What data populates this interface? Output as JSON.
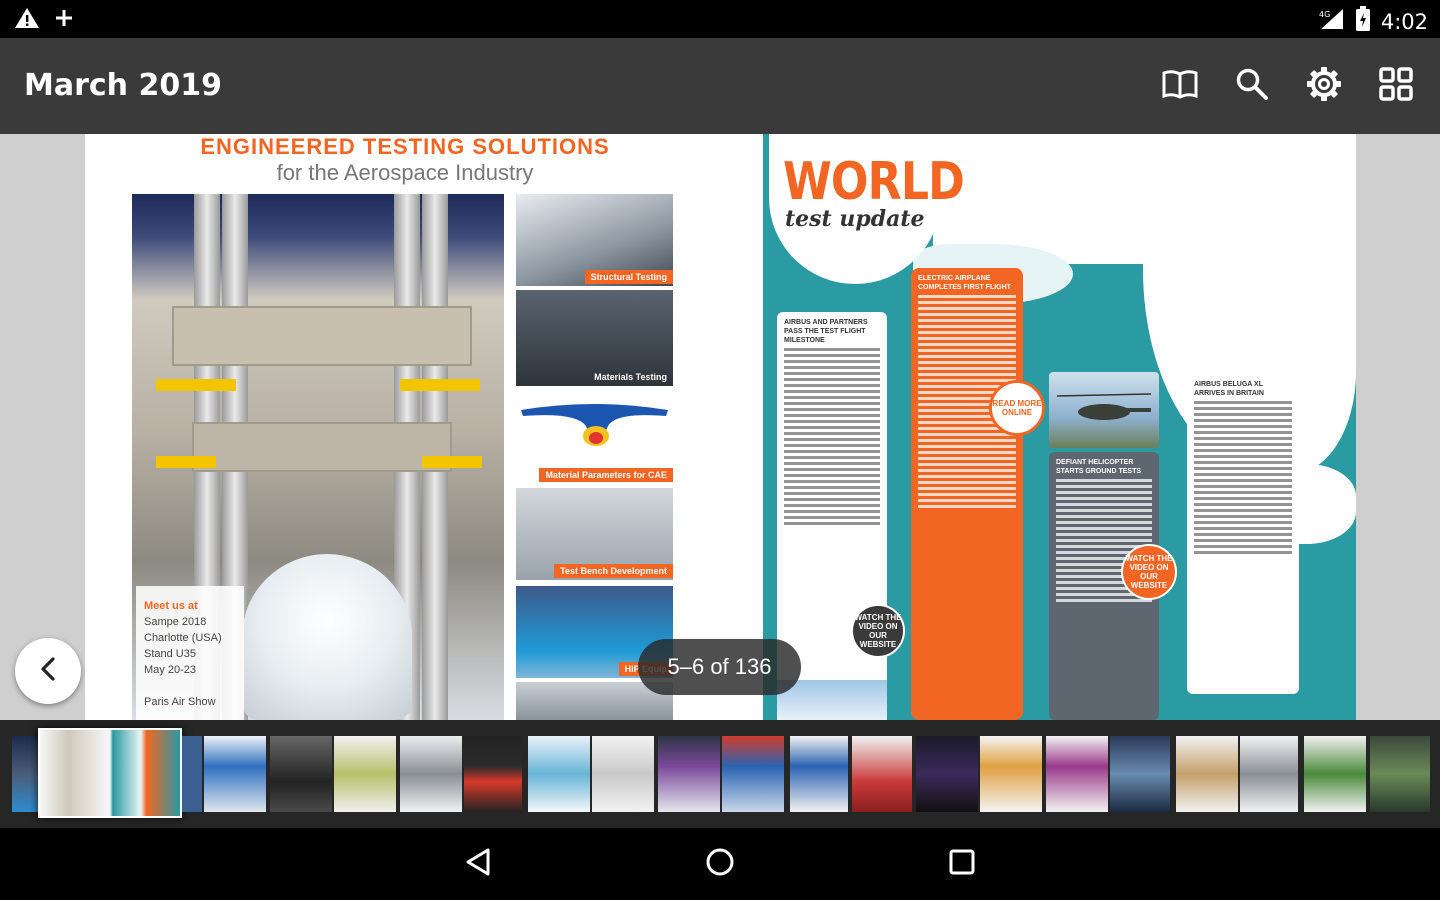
{
  "status_bar": {
    "time": "4:02",
    "left_icons": [
      "warning-icon",
      "plus-icon"
    ],
    "right_icons": [
      "signal-icon",
      "battery-icon"
    ]
  },
  "app_bar": {
    "title": "March 2019",
    "actions": [
      "book-view-icon",
      "search-icon",
      "settings-icon",
      "grid-icon"
    ]
  },
  "reader": {
    "page_indicator": "5–6 of 136",
    "left_page": {
      "headline": "ENGINEERED TESTING SOLUTIONS",
      "subheadline": "for the Aerospace Industry",
      "event_box": {
        "lines": [
          "Meet us at",
          "Sampe 2018",
          "Charlotte (USA)",
          "Stand U35",
          "May 20-23",
          "",
          "Paris Air Show"
        ]
      },
      "thumbnails": [
        {
          "caption": "Structural Testing"
        },
        {
          "caption": "Materials Testing"
        },
        {
          "caption": "Material Parameters for CAE"
        },
        {
          "caption": "Test Bench Development"
        },
        {
          "caption": "HIP Equip"
        }
      ]
    },
    "right_page": {
      "title": "WORLD",
      "subtitle": "test update",
      "articles": [
        {
          "heading": "AIRBUS AND PARTNERS PASS THE TEST FLIGHT MILESTONE"
        },
        {
          "heading": "ELECTRIC AIRPLANE COMPLETES FIRST FLIGHT"
        },
        {
          "heading": "DEFIANT HELICOPTER STARTS GROUND TESTS"
        },
        {
          "heading": "AIRBUS BELUGA XL ARRIVES IN BRITAIN"
        }
      ],
      "badges": [
        "READ MORE ONLINE",
        "WATCH THE VIDEO ON OUR WEBSITE",
        "WATCH THE VIDEO ON OUR WEBSITE"
      ]
    }
  },
  "colors": {
    "accent_orange": "#f26522",
    "map_teal": "#2a9aa3",
    "appbar": "#3a3a3a"
  }
}
